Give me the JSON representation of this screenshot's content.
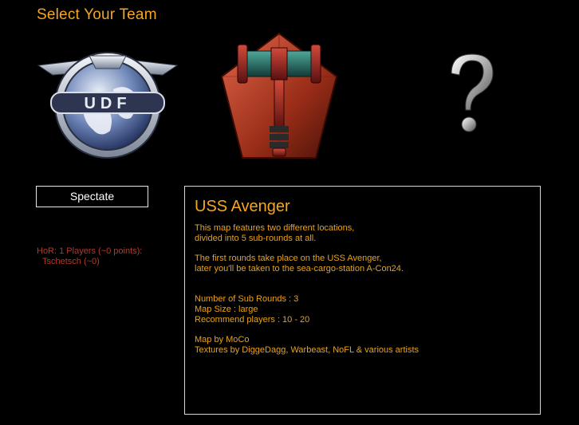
{
  "page_title": "Select Your Team",
  "teams": {
    "udf": {
      "emblem_text": "UDF",
      "icon": "udf-globe-emblem"
    },
    "hor": {
      "icon": "hammer-pentagon-emblem"
    },
    "random": {
      "icon": "question-mark-icon"
    }
  },
  "spectate_label": "Spectate",
  "roster": {
    "header": "HoR: 1 Players (~0 points):",
    "players": [
      "Tschetsch (~0)"
    ]
  },
  "map_info": {
    "title": "USS Avenger",
    "intro_line1": "This map features two different locations,",
    "intro_line2": "divided into 5 sub-rounds at all.",
    "story_line1": "The first rounds take place on the USS Avenger,",
    "story_line2": "later you'll be taken to the sea-cargo-station A-Con24.",
    "sub_rounds": "Number of Sub Rounds : 3",
    "map_size": "Map Size : large",
    "recommended_players": "Recommend players : 10 - 20",
    "author": "Map by MoCo",
    "textures": "Textures by DiggeDagg, Warbeast, NoFL & various artists"
  },
  "colors": {
    "accent": "#f5a623",
    "body_text": "#e8a317",
    "roster_text": "#b33a2a",
    "border": "#d8d8d8"
  }
}
